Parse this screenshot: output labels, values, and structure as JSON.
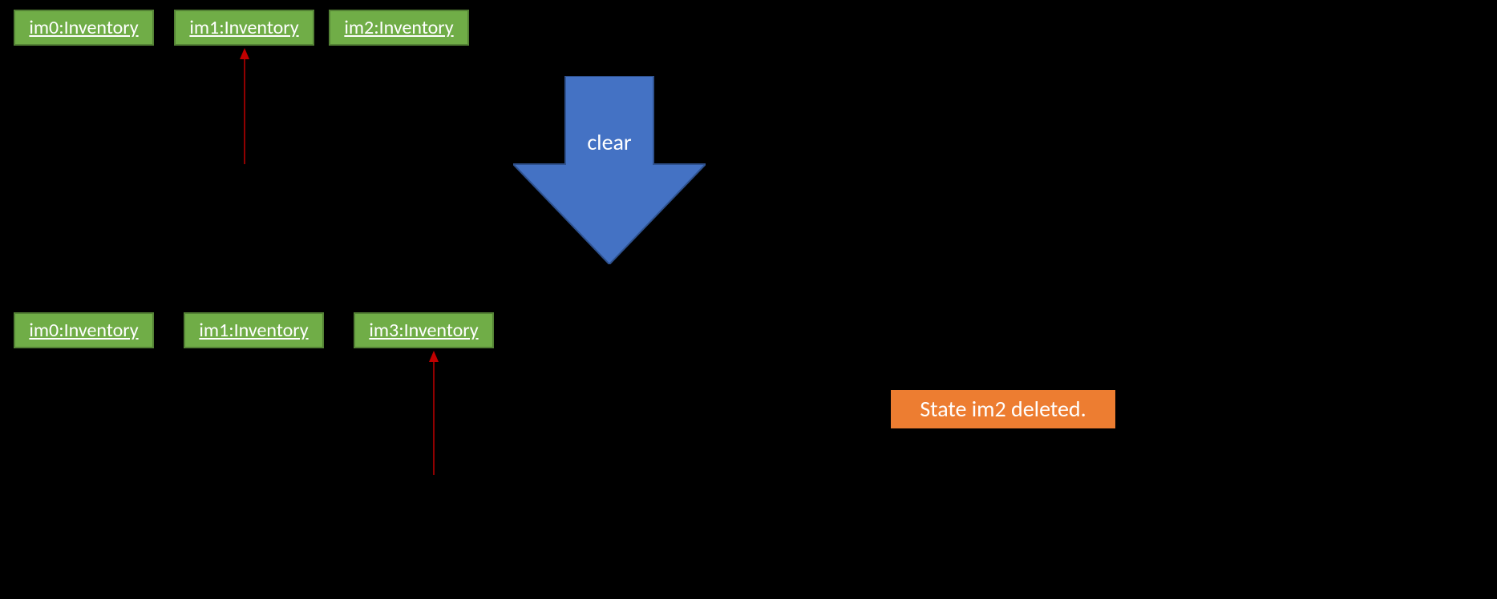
{
  "top_row": {
    "boxes": [
      {
        "label": "im0:Inventory"
      },
      {
        "label": "im1:Inventory"
      },
      {
        "label": "im2:Inventory"
      }
    ]
  },
  "bottom_row": {
    "boxes": [
      {
        "label": "im0:Inventory"
      },
      {
        "label": "im1:Inventory"
      },
      {
        "label": "im3:Inventory"
      }
    ]
  },
  "transition": {
    "label": "clear",
    "arrow_color": "#4472c4",
    "arrow_edge": "#2f528f"
  },
  "note": {
    "text": "State im2 deleted.",
    "bg": "#ed7d31"
  },
  "pointer_color": "#c00000"
}
